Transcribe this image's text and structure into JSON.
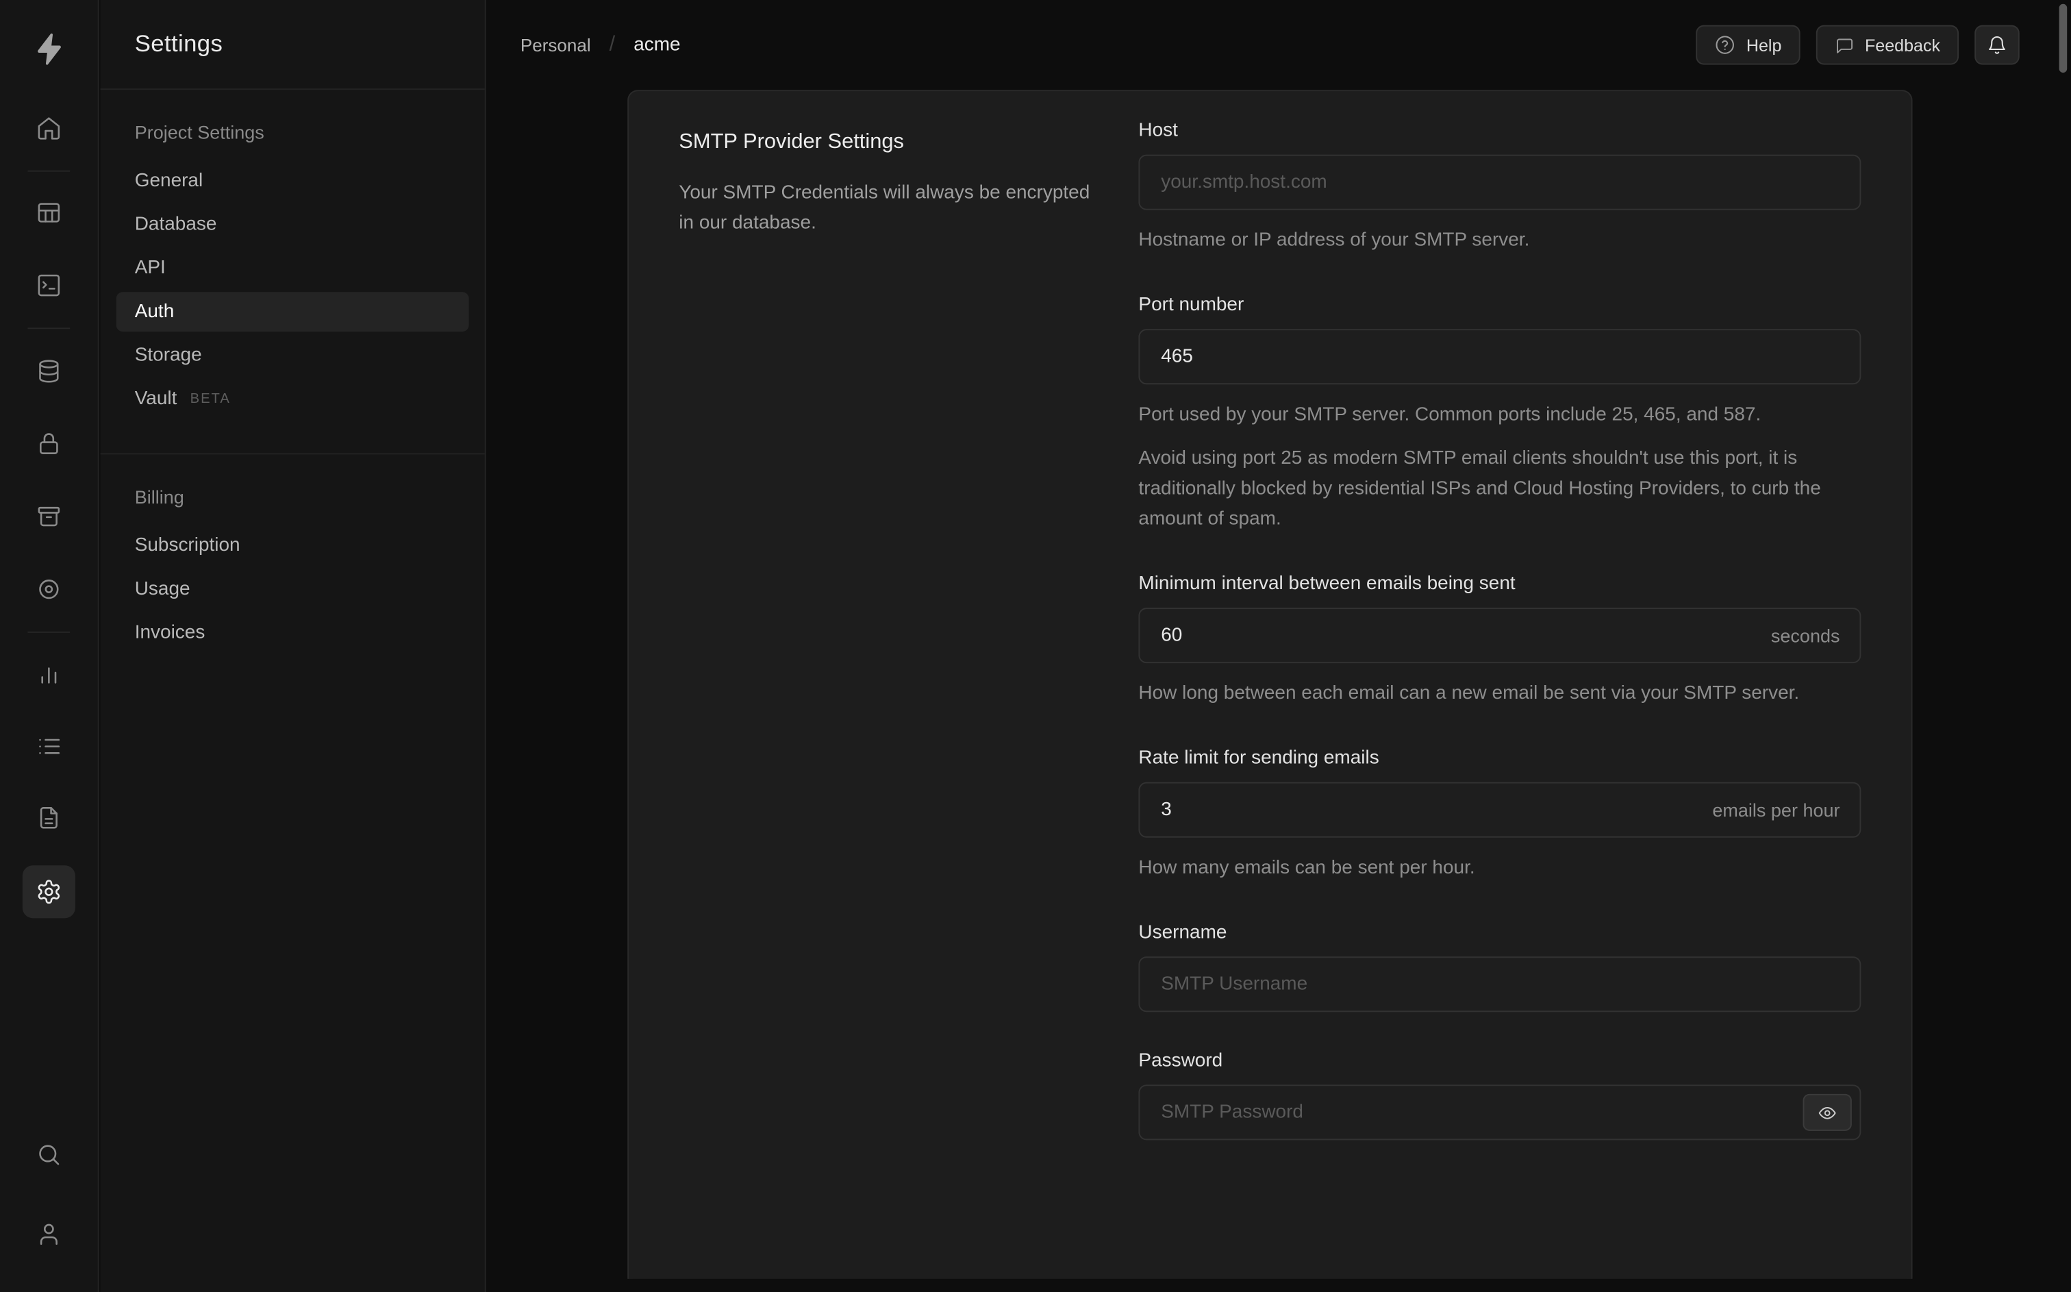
{
  "colors": {
    "app_bg": "#0d0d0d",
    "sidebar_bg": "#151515",
    "panel_bg": "#1d1d1d",
    "input_bg": "#1e1e1e",
    "border": "#2a2a2a",
    "text_primary": "#ededed",
    "text_secondary": "#8e8e8e",
    "active_item_bg": "#242424"
  },
  "icon_rail": {
    "logo": "supabase-logo",
    "items": [
      {
        "name": "home"
      },
      {
        "name": "table-editor"
      },
      {
        "name": "sql-editor"
      },
      {
        "name": "database"
      },
      {
        "name": "authentication"
      },
      {
        "name": "storage"
      },
      {
        "name": "realtime"
      },
      {
        "name": "reports"
      },
      {
        "name": "logs"
      },
      {
        "name": "api-docs"
      },
      {
        "name": "project-settings",
        "active": true
      }
    ],
    "bottom": [
      {
        "name": "search"
      },
      {
        "name": "account"
      }
    ]
  },
  "sidebar": {
    "title": "Settings",
    "sections": [
      {
        "label": "Project Settings",
        "items": [
          {
            "label": "General"
          },
          {
            "label": "Database"
          },
          {
            "label": "API"
          },
          {
            "label": "Auth",
            "active": true
          },
          {
            "label": "Storage"
          },
          {
            "label": "Vault",
            "badge": "BETA"
          }
        ]
      },
      {
        "label": "Billing",
        "items": [
          {
            "label": "Subscription"
          },
          {
            "label": "Usage"
          },
          {
            "label": "Invoices"
          }
        ]
      }
    ]
  },
  "header": {
    "breadcrumb": {
      "org": "Personal",
      "separator": "/",
      "project": "acme"
    },
    "help_label": "Help",
    "feedback_label": "Feedback",
    "notifications_icon": "bell"
  },
  "main": {
    "section": {
      "title": "SMTP Provider Settings",
      "description": "Your SMTP Credentials will always be encrypted in our database."
    },
    "fields": {
      "host": {
        "label": "Host",
        "placeholder": "your.smtp.host.com",
        "help": "Hostname or IP address of your SMTP server."
      },
      "port": {
        "label": "Port number",
        "value": "465",
        "help": "Port used by your SMTP server. Common ports include 25, 465, and 587.",
        "note": "Avoid using port 25 as modern SMTP email clients shouldn't use this port, it is traditionally blocked by residential ISPs and Cloud Hosting Providers, to curb the amount of spam."
      },
      "interval": {
        "label": "Minimum interval between emails being sent",
        "value": "60",
        "suffix": "seconds",
        "help": "How long between each email can a new email be sent via your SMTP server."
      },
      "rate_limit": {
        "label": "Rate limit for sending emails",
        "value": "3",
        "suffix": "emails per hour",
        "help": "How many emails can be sent per hour."
      },
      "username": {
        "label": "Username",
        "placeholder": "SMTP Username"
      },
      "password": {
        "label": "Password",
        "placeholder": "SMTP Password"
      }
    }
  }
}
